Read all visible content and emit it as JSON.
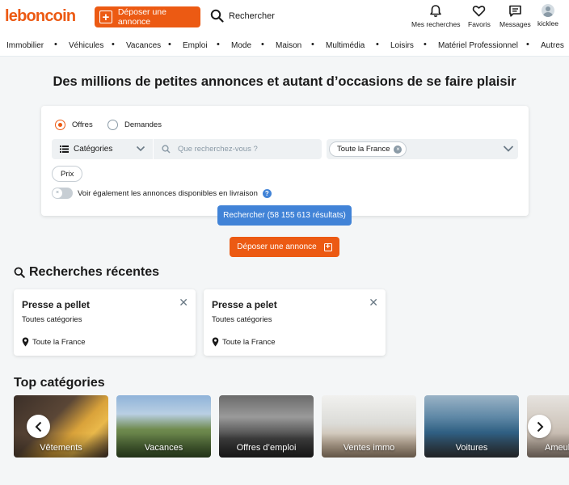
{
  "header": {
    "logo": "leboncoin",
    "deposer_label": "Déposer une annonce",
    "search_label": "Rechercher",
    "nav": [
      {
        "label": "Mes recherches",
        "icon": "bell-icon"
      },
      {
        "label": "Favoris",
        "icon": "heart-icon"
      },
      {
        "label": "Messages",
        "icon": "message-icon"
      },
      {
        "label": "kicklee",
        "icon": "avatar"
      }
    ]
  },
  "categories": [
    "Immobilier",
    "Véhicules",
    "Vacances",
    "Emploi",
    "Mode",
    "Maison",
    "Multimédia",
    "Loisirs",
    "Matériel Professionnel",
    "Autres"
  ],
  "headline": "Des millions de petites annonces et autant d’occasions de se faire plaisir",
  "search": {
    "offres_label": "Offres",
    "demandes_label": "Demandes",
    "selected_type": "Offres",
    "category_label": "Catégories",
    "query_placeholder": "Que recherchez-vous ?",
    "query_value": "",
    "location_chip": "Toute la France",
    "prix_label": "Prix",
    "livraison_label": "Voir également les annonces disponibles en livraison",
    "livraison_on": false,
    "button_label": "Rechercher (58 155 613 résultats)"
  },
  "deposer_mid_label": "Déposer une annonce",
  "recent": {
    "title": "Recherches récentes",
    "items": [
      {
        "query": "Presse a pellet",
        "category": "Toutes catégories",
        "location": "Toute la France"
      },
      {
        "query": "Presse a pelet",
        "category": "Toutes catégories",
        "location": "Toute la France"
      }
    ]
  },
  "top": {
    "title": "Top catégories",
    "tiles": [
      "Vêtements",
      "Vacances",
      "Offres d’emploi",
      "Ventes immo",
      "Voitures",
      "Ameublement"
    ]
  },
  "colors": {
    "brand": "#ec5a13",
    "primary": "#4183d7"
  }
}
